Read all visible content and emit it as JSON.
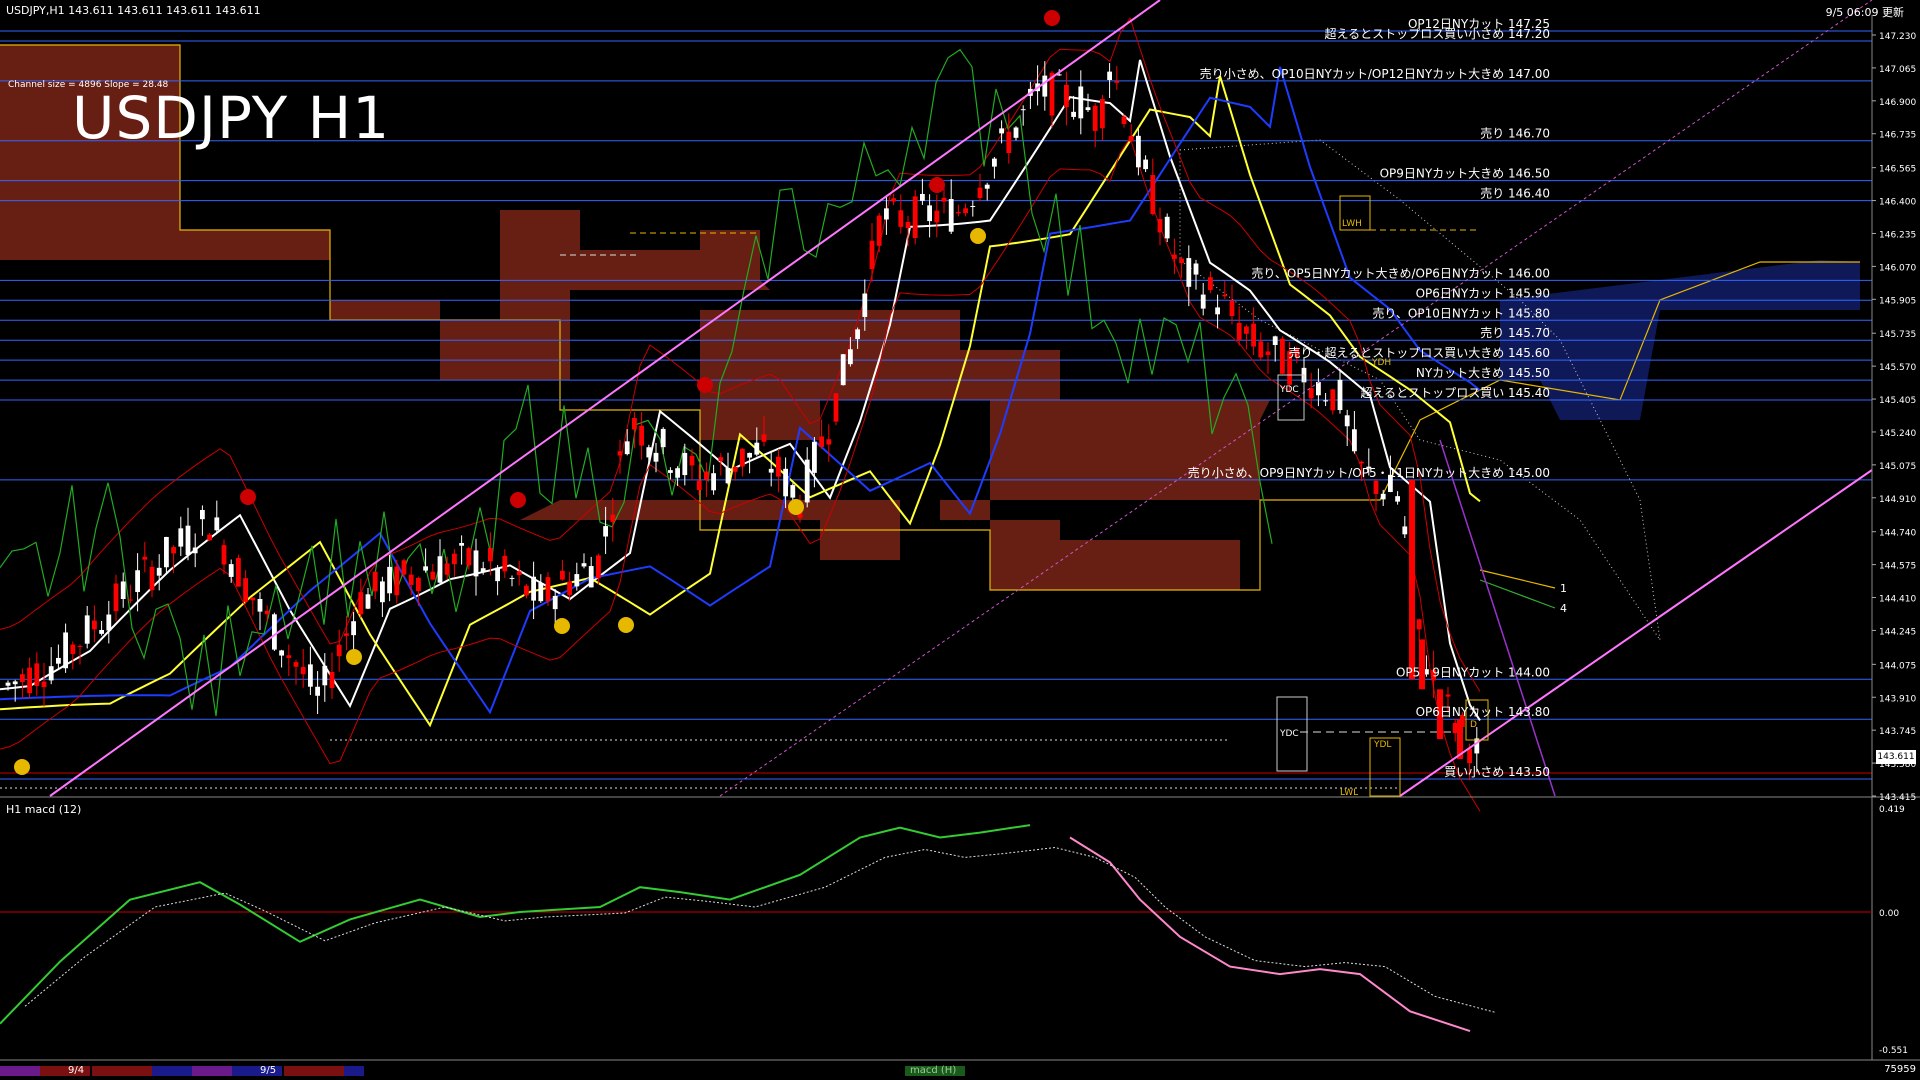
{
  "header": {
    "symbol_line": "USDJPY,H1  143.611 143.611 143.611 143.611",
    "timestamp": "9/5 06:09 更新",
    "channel_info": "Channel size = 4896 Slope = 28.48",
    "big_title": "USDJPY H1"
  },
  "price_axis": {
    "ticks": [
      "147.230",
      "147.065",
      "146.900",
      "146.735",
      "146.565",
      "146.400",
      "146.235",
      "146.070",
      "145.905",
      "145.735",
      "145.570",
      "145.405",
      "145.240",
      "145.075",
      "144.910",
      "144.740",
      "144.575",
      "144.410",
      "144.245",
      "144.075",
      "143.910",
      "143.745",
      "143.580",
      "143.415"
    ],
    "current_price": "143.611"
  },
  "levels": [
    {
      "text": "OP12日NYカット 147.25",
      "price": 147.25
    },
    {
      "text": "超えるとストップロス買い小さめ 147.20",
      "price": 147.2
    },
    {
      "text": "売り小さめ、OP10日NYカット/OP12日NYカット大きめ 147.00",
      "price": 147.0
    },
    {
      "text": "売り 146.70",
      "price": 146.7
    },
    {
      "text": "OP9日NYカット大きめ 146.50",
      "price": 146.5
    },
    {
      "text": "売り 146.40",
      "price": 146.4
    },
    {
      "text": "売り、OP5日NYカット大きめ/OP6日NYカット 146.00",
      "price": 146.0
    },
    {
      "text": "OP6日NYカット 145.90",
      "price": 145.9
    },
    {
      "text": "売り、OP10日NYカット 145.80",
      "price": 145.8
    },
    {
      "text": "売り 145.70",
      "price": 145.7
    },
    {
      "text": "売り・超えるとストップロス買い大きめ 145.60",
      "price": 145.6
    },
    {
      "text": "NYカット大きめ 145.50",
      "price": 145.5
    },
    {
      "text": "超えるとストップロス買い 145.40",
      "price": 145.4
    },
    {
      "text": "売り小さめ、OP9日NYカット/OP5・11日NYカット大きめ 145.00",
      "price": 145.0
    },
    {
      "text": "OP5・9日NYカット 144.00",
      "price": 144.0
    },
    {
      "text": "OP6日NYカット 143.80",
      "price": 143.8
    },
    {
      "text": "買い小さめ 143.50",
      "price": 143.5
    }
  ],
  "markers": {
    "ydc_1": "YDC",
    "ydc_2": "YDC",
    "ydh": "YDH",
    "ydl": "YDL",
    "lwh": "LWH",
    "lwl": "LWL",
    "label_1": "1",
    "label_4": "4",
    "d_mark": "D"
  },
  "macd": {
    "label": "H1  macd (12)",
    "ticks": [
      "0.419",
      "0.00",
      "-0.551"
    ]
  },
  "bottom_bar": {
    "date_1": "9/4",
    "date_2": "9/5",
    "tab": "macd (H)",
    "counter": "75959"
  },
  "colors": {
    "background": "#000000",
    "candle_up": "#ffffff",
    "candle_down": "#ff0000",
    "level_line": "#3366ff",
    "ma_white": "#ffffff",
    "ma_yellow": "#ffff33",
    "ma_blue": "#1e3cff",
    "channel_line": "#ff77ff",
    "macd_up": "#33cc33",
    "macd_down": "#ff88cc",
    "kumo": "#8b2a1a"
  }
}
